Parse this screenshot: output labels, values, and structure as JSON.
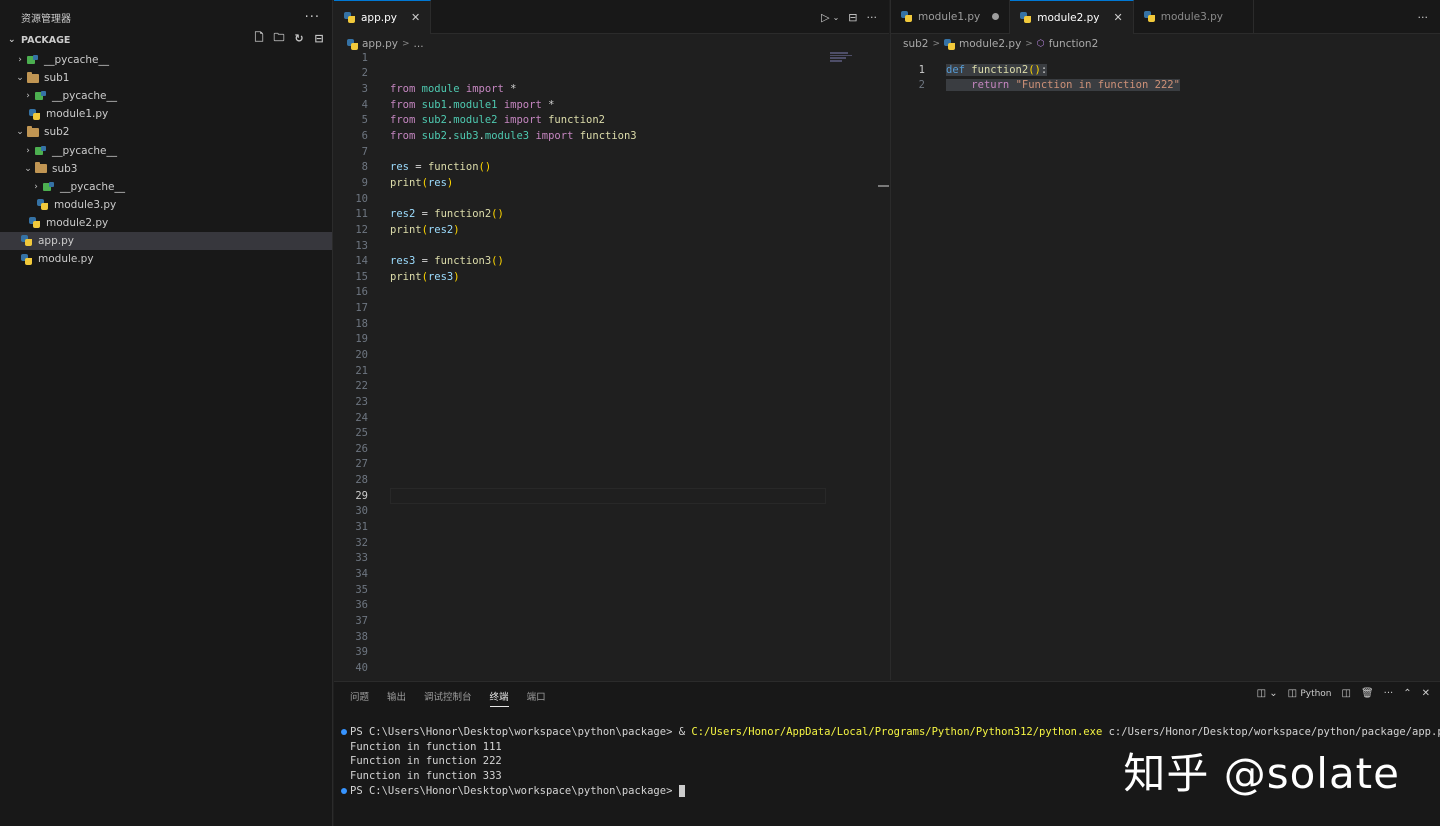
{
  "sidebar": {
    "title": "资源管理器",
    "more": "···",
    "section": "PACKAGE",
    "tree": [
      {
        "label": "__pycache__",
        "depth": 1,
        "kind": "pycache",
        "twisty": ">"
      },
      {
        "label": "sub1",
        "depth": 1,
        "kind": "folder",
        "twisty": "v"
      },
      {
        "label": "__pycache__",
        "depth": 2,
        "kind": "pycache",
        "twisty": ">"
      },
      {
        "label": "module1.py",
        "depth": 2,
        "kind": "py",
        "twisty": ""
      },
      {
        "label": "sub2",
        "depth": 1,
        "kind": "folder",
        "twisty": "v"
      },
      {
        "label": "__pycache__",
        "depth": 2,
        "kind": "pycache",
        "twisty": ">"
      },
      {
        "label": "sub3",
        "depth": 2,
        "kind": "folder",
        "twisty": "v"
      },
      {
        "label": "__pycache__",
        "depth": 3,
        "kind": "pycache",
        "twisty": ">"
      },
      {
        "label": "module3.py",
        "depth": 3,
        "kind": "py",
        "twisty": ""
      },
      {
        "label": "module2.py",
        "depth": 2,
        "kind": "py",
        "twisty": ""
      },
      {
        "label": "app.py",
        "depth": 1,
        "kind": "py",
        "twisty": "",
        "active": true
      },
      {
        "label": "module.py",
        "depth": 1,
        "kind": "py",
        "twisty": ""
      }
    ]
  },
  "editor1": {
    "tab": "app.py",
    "close": "✕",
    "crumb_file": "app.py",
    "crumb_tail": "...",
    "line_count": 40,
    "current_line": 29,
    "lines": {
      "3": [
        [
          "kw",
          "from"
        ],
        [
          "pl",
          " "
        ],
        [
          "md",
          "module"
        ],
        [
          "pl",
          " "
        ],
        [
          "kw",
          "import"
        ],
        [
          "pl",
          " *"
        ]
      ],
      "4": [
        [
          "kw",
          "from"
        ],
        [
          "pl",
          " "
        ],
        [
          "md",
          "sub1"
        ],
        [
          "pl",
          "."
        ],
        [
          "md",
          "module1"
        ],
        [
          "pl",
          " "
        ],
        [
          "kw",
          "import"
        ],
        [
          "pl",
          " *"
        ]
      ],
      "5": [
        [
          "kw",
          "from"
        ],
        [
          "pl",
          " "
        ],
        [
          "md",
          "sub2"
        ],
        [
          "pl",
          "."
        ],
        [
          "md",
          "module2"
        ],
        [
          "pl",
          " "
        ],
        [
          "kw",
          "import"
        ],
        [
          "pl",
          " "
        ],
        [
          "fn",
          "function2"
        ]
      ],
      "6": [
        [
          "kw",
          "from"
        ],
        [
          "pl",
          " "
        ],
        [
          "md",
          "sub2"
        ],
        [
          "pl",
          "."
        ],
        [
          "md",
          "sub3"
        ],
        [
          "pl",
          "."
        ],
        [
          "md",
          "module3"
        ],
        [
          "pl",
          " "
        ],
        [
          "kw",
          "import"
        ],
        [
          "pl",
          " "
        ],
        [
          "fn",
          "function3"
        ]
      ],
      "8": [
        [
          "vr",
          "res"
        ],
        [
          "pl",
          " = "
        ],
        [
          "fn",
          "function"
        ],
        [
          "br",
          "()"
        ]
      ],
      "9": [
        [
          "fn",
          "print"
        ],
        [
          "br",
          "("
        ],
        [
          "vr",
          "res"
        ],
        [
          "br",
          ")"
        ]
      ],
      "11": [
        [
          "vr",
          "res2"
        ],
        [
          "pl",
          " = "
        ],
        [
          "fn",
          "function2"
        ],
        [
          "br",
          "()"
        ]
      ],
      "12": [
        [
          "fn",
          "print"
        ],
        [
          "br",
          "("
        ],
        [
          "vr",
          "res2"
        ],
        [
          "br",
          ")"
        ]
      ],
      "14": [
        [
          "vr",
          "res3"
        ],
        [
          "pl",
          " = "
        ],
        [
          "fn",
          "function3"
        ],
        [
          "br",
          "()"
        ]
      ],
      "15": [
        [
          "fn",
          "print"
        ],
        [
          "br",
          "("
        ],
        [
          "vr",
          "res3"
        ],
        [
          "br",
          ")"
        ]
      ]
    }
  },
  "editor2": {
    "tabs": [
      {
        "label": "module1.py",
        "state": "dirty"
      },
      {
        "label": "module2.py",
        "state": "active"
      },
      {
        "label": "module3.py",
        "state": "muted"
      }
    ],
    "close": "✕",
    "crumbs": [
      "sub2",
      "module2.py",
      "function2"
    ],
    "lines": [
      [
        [
          "df",
          "def"
        ],
        [
          "pl",
          " "
        ],
        [
          "fn",
          "function2"
        ],
        [
          "br",
          "()"
        ],
        [
          "pl",
          ":"
        ]
      ],
      [
        [
          "pl",
          "    "
        ],
        [
          "kw",
          "return"
        ],
        [
          "pl",
          " "
        ],
        [
          "st",
          "\"Function in function 222\""
        ]
      ]
    ]
  },
  "panel": {
    "tabs": [
      "问题",
      "输出",
      "调试控制台",
      "终端",
      "端口"
    ],
    "active_tab": "终端",
    "shell_label": "Python",
    "terminal": [
      {
        "dot": true,
        "parts": [
          [
            "pl",
            "PS C:\\Users\\Honor\\Desktop\\workspace\\python\\package> & "
          ],
          [
            "yl",
            "C:/Users/Honor/AppData/Local/Programs/Python/Python312/python.exe"
          ],
          [
            "pl",
            " c:/Users/Honor/Desktop/workspace/python/package/app.py"
          ]
        ]
      },
      {
        "dot": false,
        "parts": [
          [
            "pl",
            "Function in function 111"
          ]
        ]
      },
      {
        "dot": false,
        "parts": [
          [
            "pl",
            "Function in function 222"
          ]
        ]
      },
      {
        "dot": false,
        "parts": [
          [
            "pl",
            "Function in function 333"
          ]
        ]
      },
      {
        "dot": true,
        "parts": [
          [
            "pl",
            "PS C:\\Users\\Honor\\Desktop\\workspace\\python\\package> "
          ]
        ],
        "cursor": true
      }
    ]
  },
  "watermark": "知乎 @solate"
}
